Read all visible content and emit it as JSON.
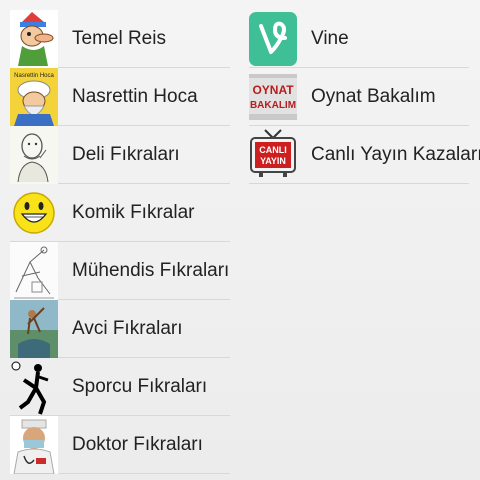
{
  "left_list": [
    {
      "label": "Temel Reis",
      "icon": "cartoon-man-icon"
    },
    {
      "label": "Nasrettin Hoca",
      "icon": "turban-man-icon",
      "icon_caption": "Nasrettin Hoca"
    },
    {
      "label": "Deli Fıkraları",
      "icon": "sketch-man-icon"
    },
    {
      "label": "Komik Fıkralar",
      "icon": "smiley-icon"
    },
    {
      "label": "Mühendis Fıkraları",
      "icon": "engineer-sketch-icon"
    },
    {
      "label": "Avci Fıkraları",
      "icon": "hunter-icon"
    },
    {
      "label": "Sporcu Fıkraları",
      "icon": "soccer-player-icon"
    },
    {
      "label": "Doktor Fıkraları",
      "icon": "doctor-icon"
    }
  ],
  "right_list": [
    {
      "label": "Vine",
      "icon": "vine-logo-icon"
    },
    {
      "label": "Oynat Bakalım",
      "icon": "oynat-bakalim-logo-icon",
      "icon_text_line1": "OYNAT",
      "icon_text_line2": "BAKALIM"
    },
    {
      "label": "Canlı Yayın Kazaları",
      "icon": "tv-icon",
      "icon_text_line1": "CANLI",
      "icon_text_line2": "YAYIN"
    }
  ],
  "colors": {
    "vine_green": "#3fbf95",
    "badge_red": "#cc1f1f",
    "background": "#f0f0f0",
    "divider": "#d8d8d8"
  }
}
